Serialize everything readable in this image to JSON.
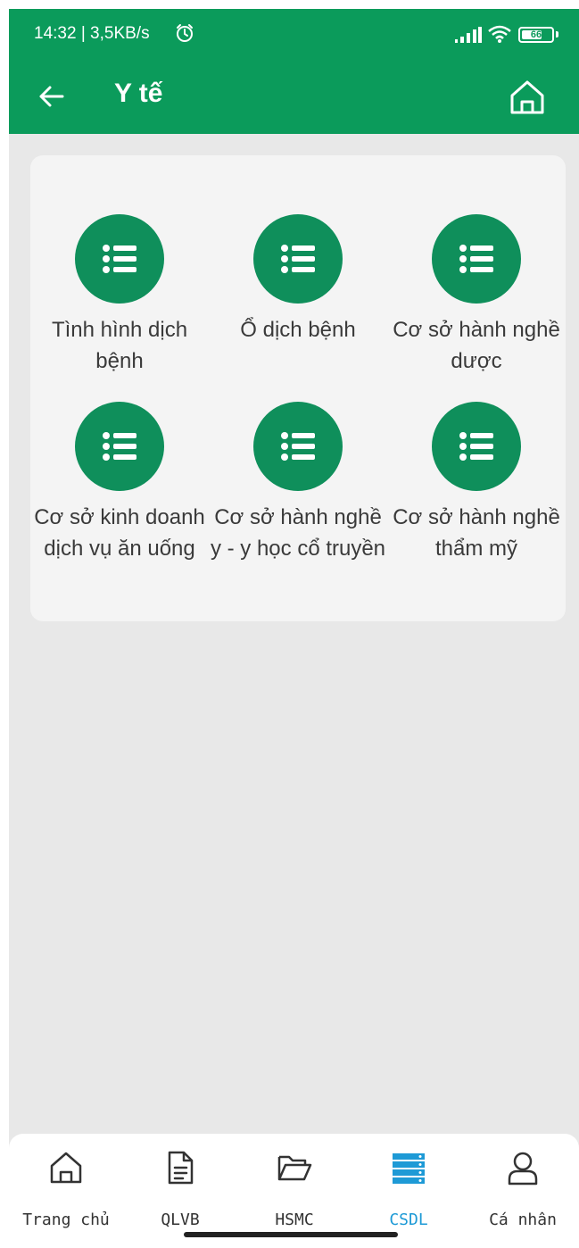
{
  "status_bar": {
    "time": "14:32 | 3,5KB/s",
    "battery": "66",
    "icons": [
      "alarm-icon",
      "signal-icon",
      "wifi-icon",
      "battery-icon"
    ]
  },
  "app_bar": {
    "title": "Y tế",
    "back_icon": "arrow-left-icon",
    "home_icon": "home-icon",
    "color": "#0b9b5b"
  },
  "grid": {
    "items": [
      {
        "label": "Tình hình dịch bệnh",
        "icon": "list-icon"
      },
      {
        "label": "Ổ dịch bệnh",
        "icon": "list-icon"
      },
      {
        "label": "Cơ sở hành nghề dược",
        "icon": "list-icon"
      },
      {
        "label": "Cơ sở kinh doanh dịch vụ ăn uống",
        "icon": "list-icon"
      },
      {
        "label": "Cơ sở hành nghề y - y học cổ truyền",
        "icon": "list-icon"
      },
      {
        "label": "Cơ sở hành nghề thẩm mỹ",
        "icon": "list-icon"
      }
    ]
  },
  "bottom_nav": {
    "items": [
      {
        "label": "Trang chủ",
        "icon": "home-icon",
        "active": false
      },
      {
        "label": "QLVB",
        "icon": "document-icon",
        "active": false
      },
      {
        "label": "HSMC",
        "icon": "folder-icon",
        "active": false
      },
      {
        "label": "CSDL",
        "icon": "database-icon",
        "active": true
      },
      {
        "label": "Cá nhân",
        "icon": "user-icon",
        "active": false
      }
    ],
    "active_color": "#1e9ad6"
  }
}
